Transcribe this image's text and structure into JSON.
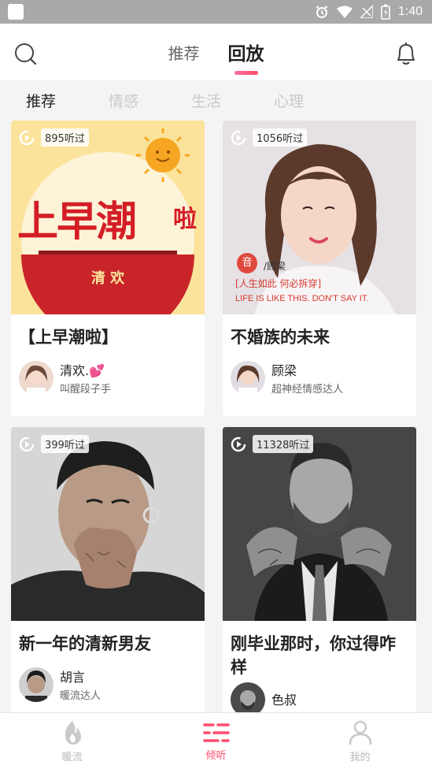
{
  "status_bar": {
    "time": "1:40"
  },
  "header": {
    "tabs": [
      {
        "label": "推荐",
        "active": false
      },
      {
        "label": "回放",
        "active": true
      }
    ]
  },
  "categories": [
    {
      "label": "推荐",
      "active": true
    },
    {
      "label": "情感",
      "active": false
    },
    {
      "label": "生活",
      "active": false
    },
    {
      "label": "心理",
      "active": false
    }
  ],
  "cards": [
    {
      "listen_count": "895听过",
      "cover_text": {
        "main": "上早潮",
        "suffix": "啦",
        "host": "清 欢"
      },
      "title": "【上早潮啦】",
      "author_name": "清欢.",
      "author_desc": "叫醒段子手"
    },
    {
      "listen_count": "1056听过",
      "cover_text": {
        "tag": "/顾梁",
        "quote": "[人生如此 何必拆穿]",
        "english": "LIFE IS LIKE THIS. DON'T SAY IT."
      },
      "title": "不婚族的未来",
      "author_name": "顾梁",
      "author_desc": "超神经情感达人"
    },
    {
      "listen_count": "399听过",
      "title": "新一年的清新男友",
      "author_name": "胡言",
      "author_desc": "暖流达人"
    },
    {
      "listen_count": "11328听过",
      "title": "刚毕业那时，你过得咋样",
      "author_name": "色叔",
      "author_desc": ""
    }
  ],
  "bottom_nav": [
    {
      "label": "暖流",
      "icon": "flame-icon",
      "active": false
    },
    {
      "label": "倾听",
      "icon": "listen-icon",
      "active": true
    },
    {
      "label": "我的",
      "icon": "profile-icon",
      "active": false
    }
  ],
  "colors": {
    "accent": "#ff4d6d",
    "status_bar": "#a9a9a9"
  }
}
